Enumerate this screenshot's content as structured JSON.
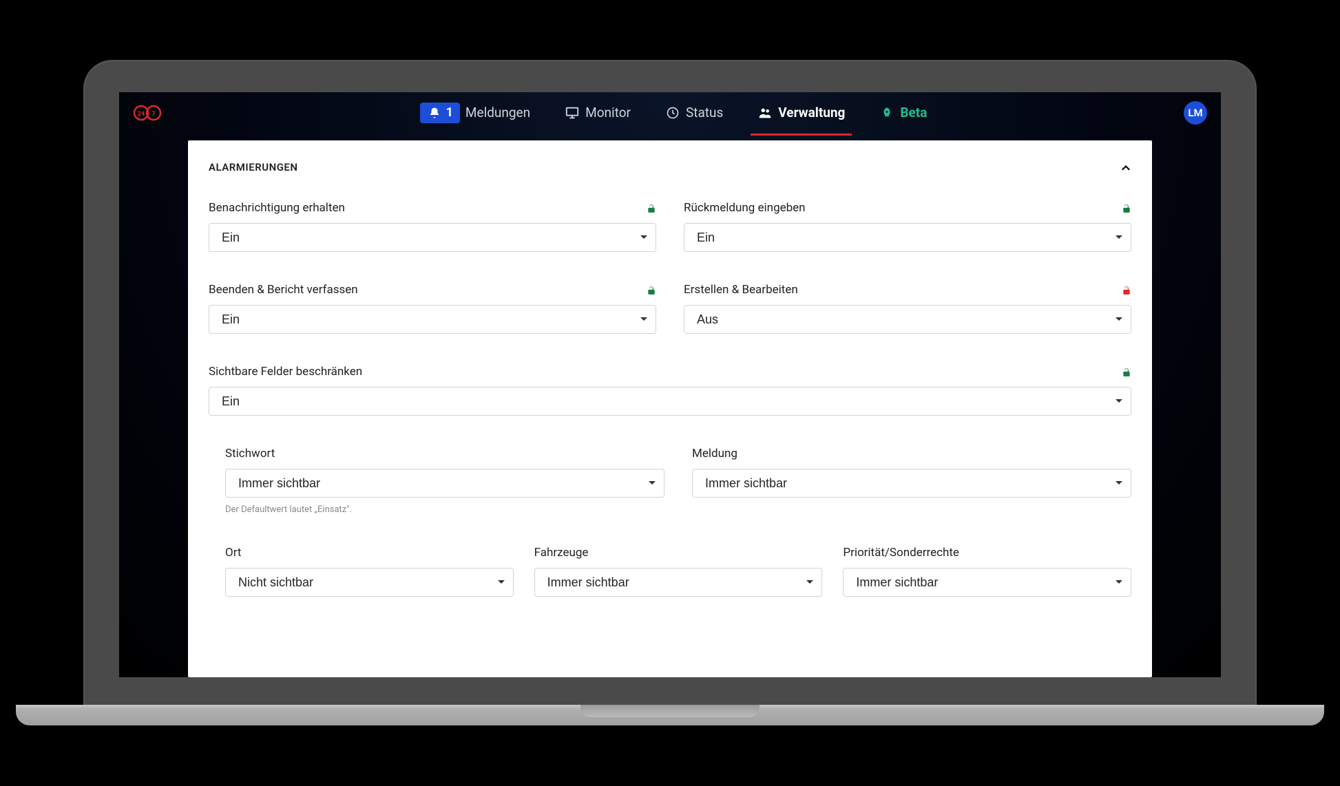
{
  "nav": {
    "badge_count": "1",
    "items": [
      {
        "label": "Meldungen"
      },
      {
        "label": "Monitor"
      },
      {
        "label": "Status"
      },
      {
        "label": "Verwaltung"
      },
      {
        "label": "Beta"
      }
    ]
  },
  "avatar": "LM",
  "section": {
    "title": "ALARMIERUNGEN"
  },
  "fields": {
    "benachrichtigung": {
      "label": "Benachrichtigung erhalten",
      "value": "Ein"
    },
    "rueckmeldung": {
      "label": "Rückmeldung eingeben",
      "value": "Ein"
    },
    "beenden": {
      "label": "Beenden & Bericht verfassen",
      "value": "Ein"
    },
    "erstellen": {
      "label": "Erstellen & Bearbeiten",
      "value": "Aus"
    },
    "sichtbare": {
      "label": "Sichtbare Felder beschränken",
      "value": "Ein"
    },
    "stichwort": {
      "label": "Stichwort",
      "value": "Immer sichtbar",
      "helper": "Der Defaultwert lautet „Einsatz\"."
    },
    "meldung": {
      "label": "Meldung",
      "value": "Immer sichtbar"
    },
    "ort": {
      "label": "Ort",
      "value": "Nicht sichtbar"
    },
    "fahrzeuge": {
      "label": "Fahrzeuge",
      "value": "Immer sichtbar"
    },
    "prioritaet": {
      "label": "Priorität/Sonderrechte",
      "value": "Immer sichtbar"
    }
  },
  "options": {
    "onoff": [
      "Ein",
      "Aus"
    ],
    "visibility": [
      "Immer sichtbar",
      "Nicht sichtbar"
    ]
  }
}
